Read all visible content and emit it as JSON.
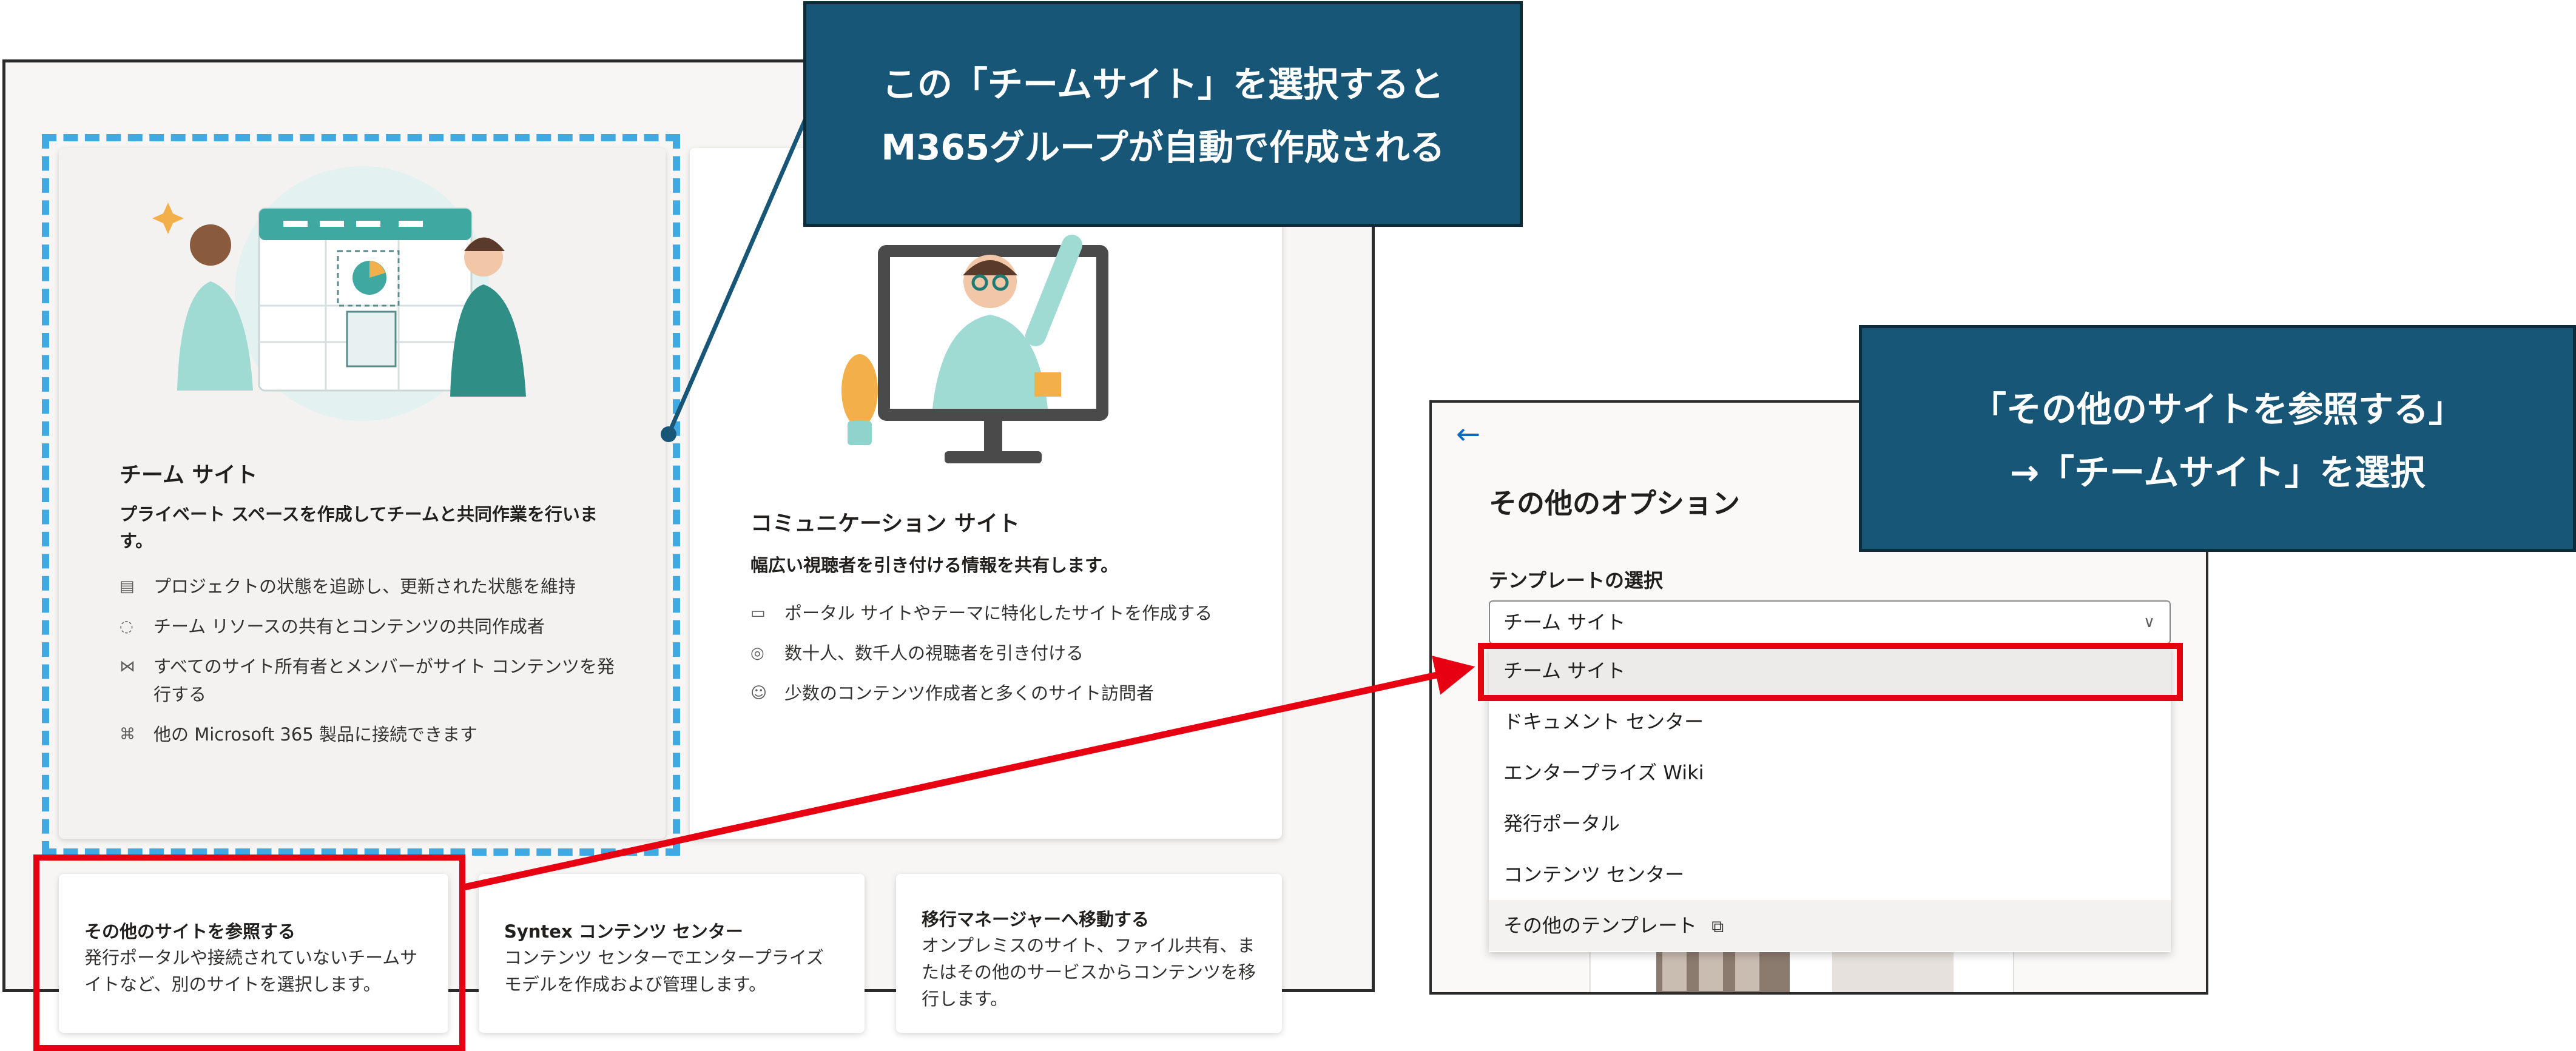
{
  "team_card": {
    "title": "チーム サイト",
    "subtitle": "プライベート スペースを作成してチームと共同作業を行います。",
    "bullets": [
      "プロジェクトの状態を追跡し、更新された状態を維持",
      "チーム リソースの共有とコンテンツの共同作成者",
      "すべてのサイト所有者とメンバーがサイト コンテンツを発行する",
      "他の Microsoft 365 製品に接続できます"
    ]
  },
  "comm_card": {
    "title": "コミュニケーション サイト",
    "subtitle": "幅広い視聴者を引き付ける情報を共有します。",
    "bullets": [
      "ポータル サイトやテーマに特化したサイトを作成する",
      "数十人、数千人の視聴者を引き付ける",
      "少数のコンテンツ作成者と多くのサイト訪問者"
    ]
  },
  "small_cards": [
    {
      "title": "その他のサイトを参照する",
      "desc": "発行ポータルや接続されていないチームサイトなど、別のサイトを選択します。"
    },
    {
      "title": "Syntex コンテンツ センター",
      "desc": "コンテンツ センターでエンタープライズ モデルを作成および管理します。"
    },
    {
      "title": "移行マネージャーへ移動する",
      "desc": "オンプレミスのサイト、ファイル共有、またはその他のサービスからコンテンツを移行します。"
    }
  ],
  "options_panel": {
    "title": "その他のオプション",
    "template_label": "テンプレートの選択",
    "selected_value": "チーム サイト",
    "options": [
      "チーム サイト",
      "ドキュメント センター",
      "エンタープライズ Wiki",
      "発行ポータル",
      "コンテンツ センター",
      "その他のテンプレート"
    ]
  },
  "callouts": {
    "top_line1": "この「チームサイト」を選択すると",
    "top_line2": "M365グループが自動で作成される",
    "right_line1": "「その他のサイトを参照する」",
    "right_line2": "→「チームサイト」を選択"
  },
  "colors": {
    "callout_bg": "#175676",
    "highlight_red": "#e60012",
    "highlight_blue": "#40a9e2",
    "accent": "#0f6cbd"
  },
  "icons": [
    "clipboard-icon",
    "sync-icon",
    "share-icon",
    "apps-icon",
    "news-icon",
    "broadcast-icon",
    "people-icon",
    "back-arrow-icon",
    "chevron-down-icon",
    "external-link-icon"
  ]
}
